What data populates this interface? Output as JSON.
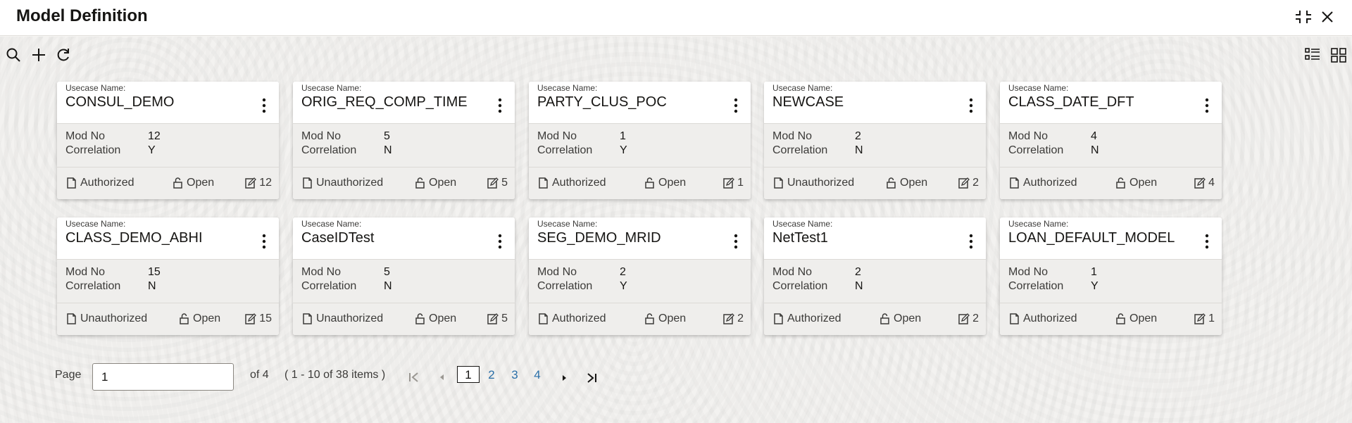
{
  "title": "Model Definition",
  "window": {
    "minimize_icon": "collapse-icon",
    "close_icon": "close-icon"
  },
  "toolbar": {
    "search_icon": "search-icon",
    "add_icon": "plus-icon",
    "refresh_icon": "refresh-icon",
    "list_view_icon": "list-view-icon",
    "grid_view_icon": "grid-view-icon"
  },
  "labels": {
    "usecase_name": "Usecase Name:",
    "mod_no": "Mod No",
    "correlation": "Correlation"
  },
  "cards": [
    {
      "name": "CONSUL_DEMO",
      "mod_no": "12",
      "correlation": "Y",
      "auth": "Authorized",
      "lock": "Open",
      "edits": "12"
    },
    {
      "name": "ORIG_REQ_COMP_TIME",
      "mod_no": "5",
      "correlation": "N",
      "auth": "Unauthorized",
      "lock": "Open",
      "edits": "5"
    },
    {
      "name": "PARTY_CLUS_POC",
      "mod_no": "1",
      "correlation": "Y",
      "auth": "Authorized",
      "lock": "Open",
      "edits": "1"
    },
    {
      "name": "NEWCASE",
      "mod_no": "2",
      "correlation": "N",
      "auth": "Unauthorized",
      "lock": "Open",
      "edits": "2"
    },
    {
      "name": "CLASS_DATE_DFT",
      "mod_no": "4",
      "correlation": "N",
      "auth": "Authorized",
      "lock": "Open",
      "edits": "4"
    },
    {
      "name": "CLASS_DEMO_ABHI",
      "mod_no": "15",
      "correlation": "N",
      "auth": "Unauthorized",
      "lock": "Open",
      "edits": "15"
    },
    {
      "name": "CaseIDTest",
      "mod_no": "5",
      "correlation": "N",
      "auth": "Unauthorized",
      "lock": "Open",
      "edits": "5"
    },
    {
      "name": "SEG_DEMO_MRID",
      "mod_no": "2",
      "correlation": "Y",
      "auth": "Authorized",
      "lock": "Open",
      "edits": "2"
    },
    {
      "name": "NetTest1",
      "mod_no": "2",
      "correlation": "N",
      "auth": "Authorized",
      "lock": "Open",
      "edits": "2"
    },
    {
      "name": "LOAN_DEFAULT_MODEL",
      "mod_no": "1",
      "correlation": "Y",
      "auth": "Authorized",
      "lock": "Open",
      "edits": "1"
    }
  ],
  "pagination": {
    "page_label": "Page",
    "page_value": "1",
    "of_pages": "of 4",
    "items_summary": "( 1 - 10 of 38 items )",
    "pages": [
      "1",
      "2",
      "3",
      "4"
    ],
    "current_page": "1"
  },
  "colors": {
    "accent_link": "#2a6fa8",
    "card_body": "#efeeec",
    "background": "#f3f2f0"
  }
}
